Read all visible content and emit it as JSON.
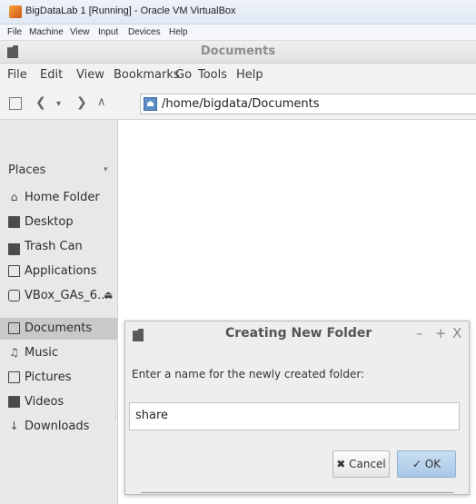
{
  "vbox": {
    "title": "BigDataLab 1 [Running] - Oracle VM VirtualBox",
    "menu": [
      "File",
      "Machine",
      "View",
      "Input",
      "Devices",
      "Help"
    ]
  },
  "filemanager": {
    "title": "Documents",
    "menu": [
      "File",
      "Edit",
      "View",
      "Bookmarks",
      "Go",
      "Tools",
      "Help"
    ],
    "location": "/home/bigdata/Documents",
    "toolbar_icons": [
      "new-tab-icon",
      "back-icon",
      "menu-down-icon",
      "forward-icon",
      "up-icon",
      "home-location-icon"
    ]
  },
  "sidebar": {
    "heading": "Places",
    "items": [
      {
        "label": "Home Folder",
        "icon": "home-icon"
      },
      {
        "label": "Desktop",
        "icon": "desktop-icon"
      },
      {
        "label": "Trash Can",
        "icon": "trash-icon"
      },
      {
        "label": "Applications",
        "icon": "applications-icon"
      },
      {
        "label": "VBox_GAs_6....",
        "icon": "disc-icon"
      },
      {
        "label": "Documents",
        "icon": "documents-icon"
      },
      {
        "label": "Music",
        "icon": "music-icon"
      },
      {
        "label": "Pictures",
        "icon": "pictures-icon"
      },
      {
        "label": "Videos",
        "icon": "videos-icon"
      },
      {
        "label": "Downloads",
        "icon": "downloads-icon"
      }
    ],
    "active": "Documents"
  },
  "dialog": {
    "title": "Creating New Folder",
    "controls": [
      "–",
      "+",
      "X"
    ],
    "prompt": "Enter a name for the newly created folder:",
    "input_value": "share",
    "cancel_label": "Cancel",
    "ok_label": "OK",
    "accent": "#a8c7e6"
  },
  "glyphs": {
    "cancel": "✖",
    "ok": "✓",
    "eject": "⏏",
    "collapse": "▾"
  }
}
